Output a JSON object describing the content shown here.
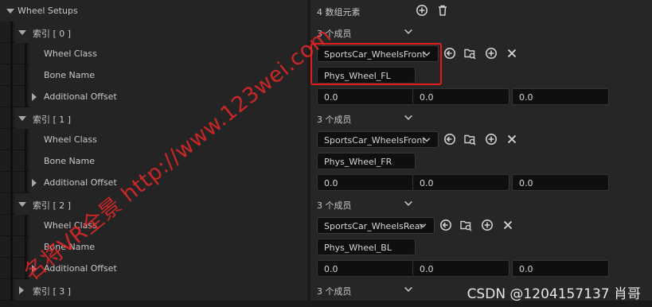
{
  "details": {
    "wheel_setups": {
      "label": "Wheel Setups",
      "value": "4 数组元素"
    },
    "labels": {
      "wheel_class": "Wheel Class",
      "bone_name": "Bone Name",
      "additional_offset": "Additional Offset"
    },
    "wheels": [
      {
        "index": "索引 [ 0 ]",
        "members": "3 个成员",
        "wheel_class": "SportsCar_WheelsFront",
        "bone_name": "Phys_Wheel_FL",
        "offset": [
          "0.0",
          "0.0",
          "0.0"
        ]
      },
      {
        "index": "索引 [ 1 ]",
        "members": "3 个成员",
        "wheel_class": "SportsCar_WheelsFront",
        "bone_name": "Phys_Wheel_FR",
        "offset": [
          "0.0",
          "0.0",
          "0.0"
        ]
      },
      {
        "index": "索引 [ 2 ]",
        "members": "3 个成员",
        "wheel_class": "SportsCar_WheelsRear",
        "bone_name": "Phys_Wheel_BL",
        "offset": [
          "0.0",
          "0.0",
          "0.0"
        ]
      },
      {
        "index": "索引 [ 3 ]",
        "members": "3 个成员"
      }
    ]
  },
  "overlays": {
    "watermark": "名将VR全景 http://www.123wei.com",
    "credit": "CSDN @1204157137 肖哥",
    "highlight_color": "#e31c1c"
  },
  "icons": [
    "add-element-icon",
    "delete-all-icon",
    "chevron-down-icon",
    "use-selected-icon",
    "browse-icon",
    "add-icon",
    "clear-icon"
  ]
}
